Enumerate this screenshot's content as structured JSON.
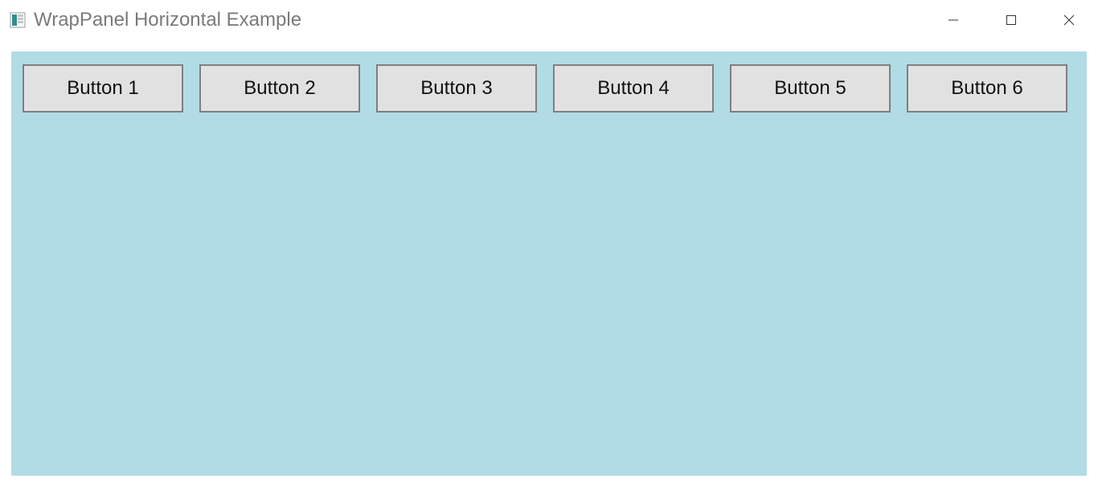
{
  "window": {
    "title": "WrapPanel Horizontal Example"
  },
  "panel": {
    "background_color": "#b1dce5",
    "buttons": [
      {
        "label": "Button 1"
      },
      {
        "label": "Button 2"
      },
      {
        "label": "Button 3"
      },
      {
        "label": "Button 4"
      },
      {
        "label": "Button 5"
      },
      {
        "label": "Button 6"
      }
    ]
  }
}
